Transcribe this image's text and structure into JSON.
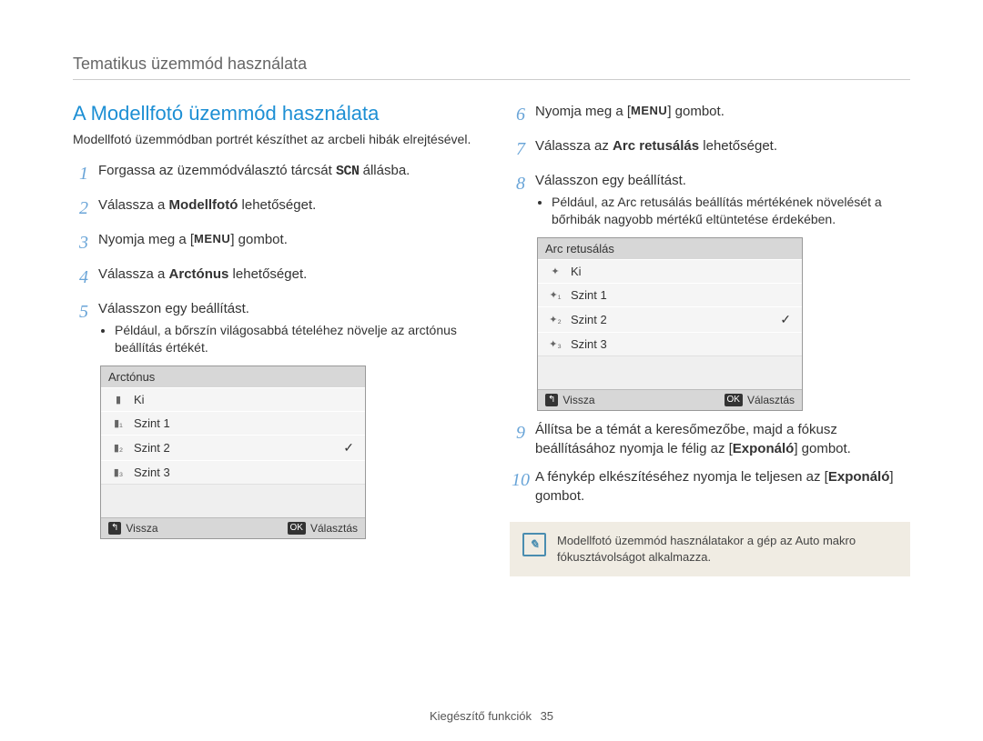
{
  "header": "Tematikus üzemmód használata",
  "section_title": "A Modellfotó üzemmód használata",
  "intro": "Modellfotó üzemmódban portrét készíthet az arcbeli hibák elrejtésével.",
  "left_steps": [
    {
      "num": "1",
      "html": "Forgassa az üzemmódválasztó tárcsát <span class='scn'>SCN</span> állásba."
    },
    {
      "num": "2",
      "html": "Válassza a <span class='bold'>Modellfotó</span> lehetőséget."
    },
    {
      "num": "3",
      "html": "Nyomja meg a [<span class='menu-glyph'>MENU</span>] gombot."
    },
    {
      "num": "4",
      "html": "Válassza a <span class='bold'>Arctónus</span>  lehetőséget."
    },
    {
      "num": "5",
      "html": "Válasszon egy beállítást.",
      "bullet": "Például, a bőrszín világosabbá tételéhez növelje az arctónus beállítás értékét."
    }
  ],
  "right_steps": [
    {
      "num": "6",
      "html": "Nyomja meg a [<span class='menu-glyph'>MENU</span>] gombot."
    },
    {
      "num": "7",
      "html": "Válassza az <span class='bold'>Arc retusálás</span> lehetőséget."
    },
    {
      "num": "8",
      "html": "Válasszon egy beállítást.",
      "bullet": "Például, az Arc retusálás beállítás mértékének növelését a bőrhibák nagyobb mértékű eltüntetése érdekében."
    },
    {
      "num": "9",
      "html": "Állítsa be a témát a keresőmezőbe, majd a fókusz beállításához nyomja le félig az [<span class='bold'>Exponáló</span>] gombot."
    },
    {
      "num": "10",
      "html": "A fénykép elkészítéséhez nyomja le teljesen az [<span class='bold'>Exponáló</span>] gombot."
    }
  ],
  "menu_a": {
    "title": "Arctónus",
    "rows": [
      {
        "ico": "▮",
        "lbl": "Ki",
        "checked": false
      },
      {
        "ico": "▮₁",
        "lbl": "Szint 1",
        "checked": false
      },
      {
        "ico": "▮₂",
        "lbl": "Szint 2",
        "checked": true
      },
      {
        "ico": "▮₃",
        "lbl": "Szint 3",
        "checked": false
      }
    ],
    "back": "Vissza",
    "select": "Választás"
  },
  "menu_b": {
    "title": "Arc retusálás",
    "rows": [
      {
        "ico": "✦",
        "lbl": "Ki",
        "checked": false
      },
      {
        "ico": "✦₁",
        "lbl": "Szint 1",
        "checked": false
      },
      {
        "ico": "✦₂",
        "lbl": "Szint 2",
        "checked": true
      },
      {
        "ico": "✦₃",
        "lbl": "Szint 3",
        "checked": false
      }
    ],
    "back": "Vissza",
    "select": "Választás"
  },
  "note": "Modellfotó üzemmód használatakor a gép az Auto makro fókusztávolságot alkalmazza.",
  "footer": {
    "section": "Kiegészítő funkciók",
    "page": "35"
  },
  "key_back": "↰",
  "key_ok": "OK"
}
